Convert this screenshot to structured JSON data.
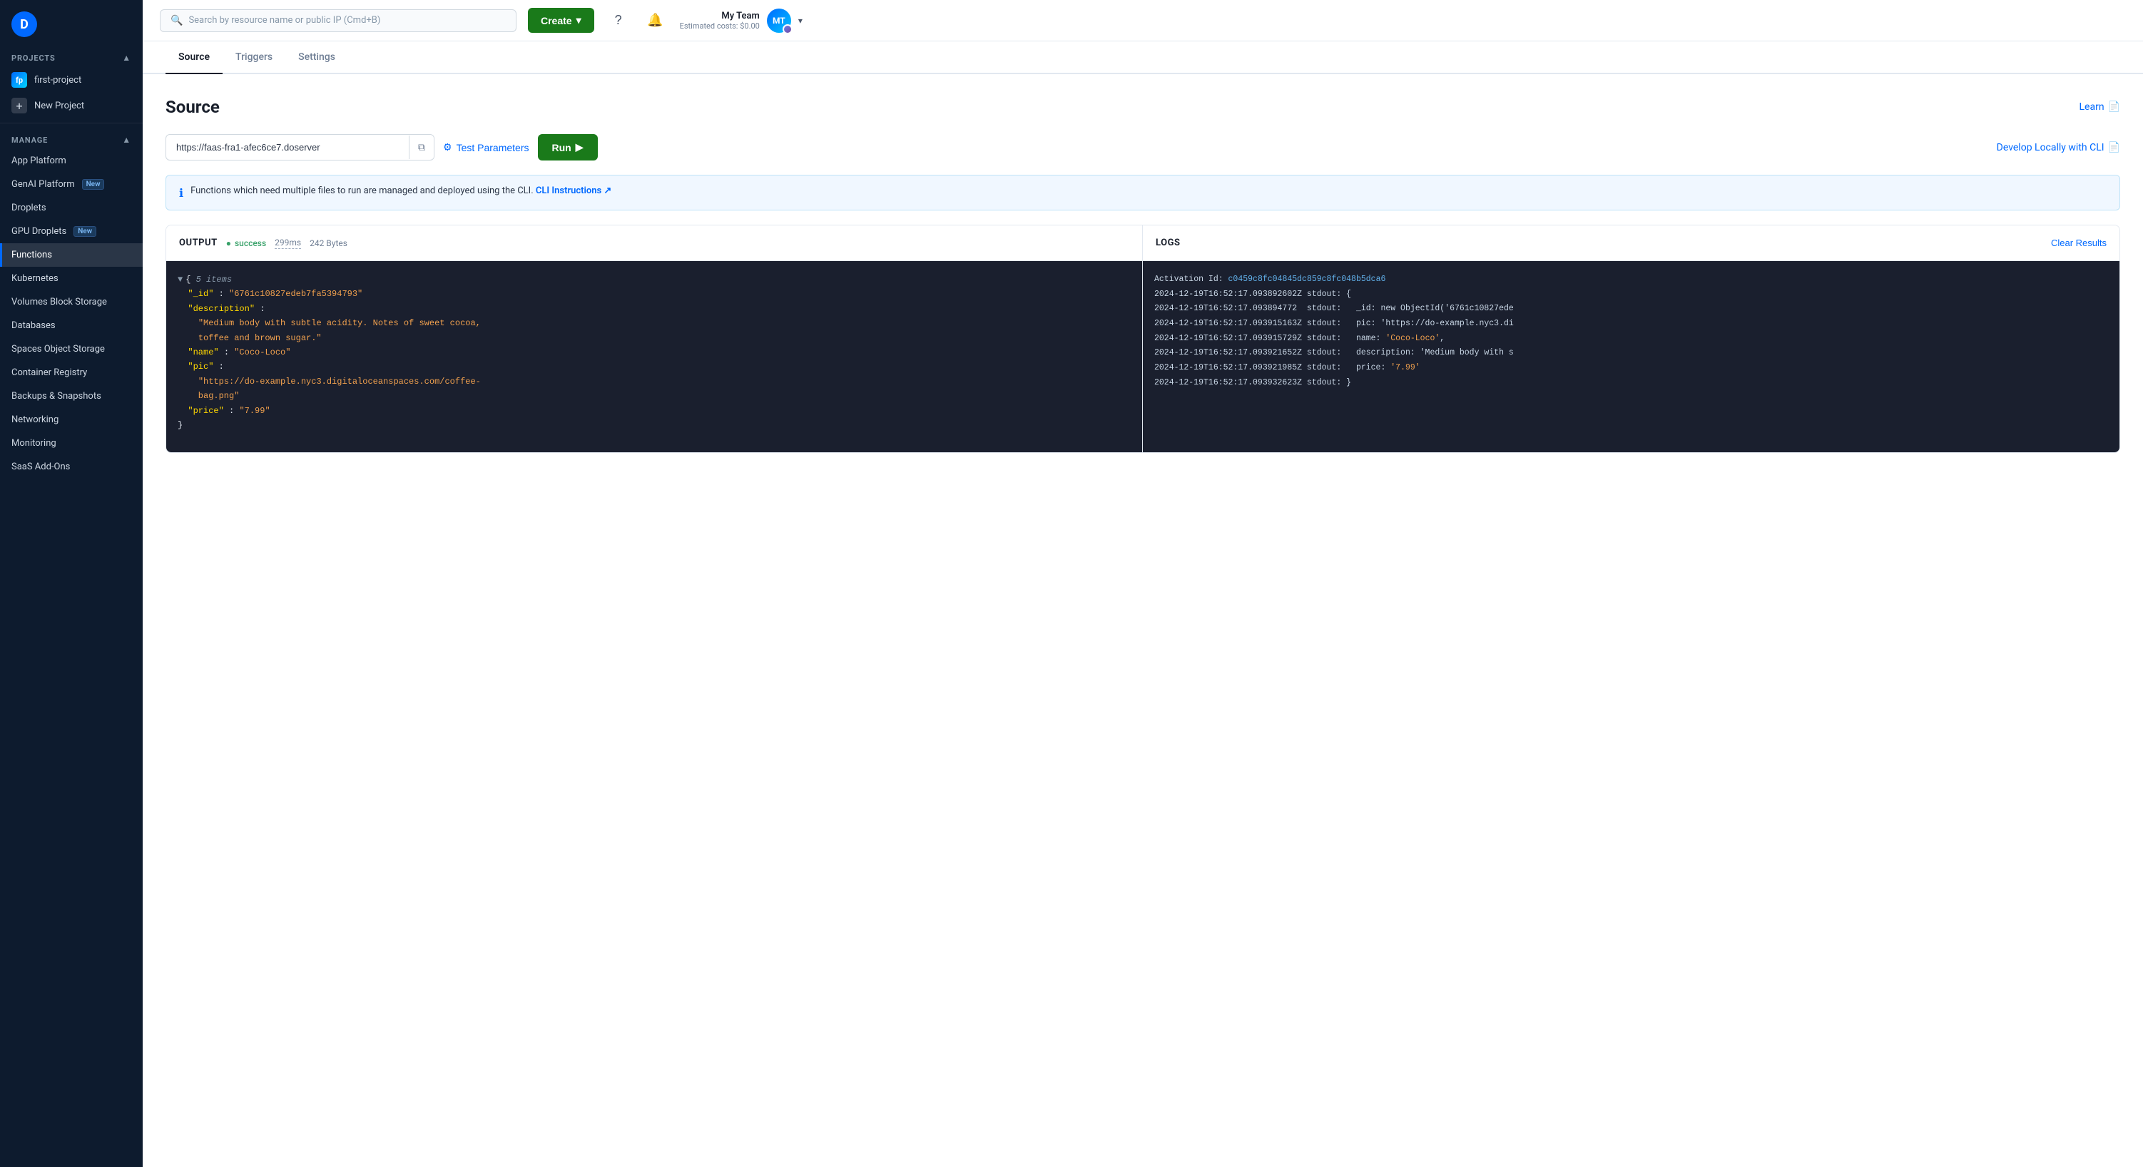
{
  "sidebar": {
    "logo_text": "D",
    "projects_section": "PROJECTS",
    "chevron_up": "▲",
    "projects": [
      {
        "id": "first-project",
        "label": "first-project",
        "icon_type": "gradient"
      }
    ],
    "new_project_label": "New Project",
    "manage_section": "MANAGE",
    "nav_items": [
      {
        "id": "app-platform",
        "label": "App Platform",
        "badge": null,
        "active": false
      },
      {
        "id": "genai-platform",
        "label": "GenAI Platform",
        "badge": "New",
        "active": false
      },
      {
        "id": "droplets",
        "label": "Droplets",
        "badge": null,
        "active": false
      },
      {
        "id": "gpu-droplets",
        "label": "GPU Droplets",
        "badge": "New",
        "active": false
      },
      {
        "id": "functions",
        "label": "Functions",
        "badge": null,
        "active": true
      },
      {
        "id": "kubernetes",
        "label": "Kubernetes",
        "badge": null,
        "active": false
      },
      {
        "id": "volumes-block-storage",
        "label": "Volumes Block Storage",
        "badge": null,
        "active": false
      },
      {
        "id": "databases",
        "label": "Databases",
        "badge": null,
        "active": false
      },
      {
        "id": "spaces-object-storage",
        "label": "Spaces Object Storage",
        "badge": null,
        "active": false
      },
      {
        "id": "container-registry",
        "label": "Container Registry",
        "badge": null,
        "active": false
      },
      {
        "id": "backups-snapshots",
        "label": "Backups & Snapshots",
        "badge": null,
        "active": false
      },
      {
        "id": "networking",
        "label": "Networking",
        "badge": null,
        "active": false
      },
      {
        "id": "monitoring",
        "label": "Monitoring",
        "badge": null,
        "active": false
      },
      {
        "id": "saas-add-ons",
        "label": "SaaS Add-Ons",
        "badge": null,
        "active": false
      }
    ]
  },
  "topnav": {
    "search_placeholder": "Search by resource name or public IP (Cmd+B)",
    "create_label": "Create",
    "user_name": "My Team",
    "user_cost": "Estimated costs: $0.00",
    "avatar_initials": "MT"
  },
  "tabs": [
    {
      "id": "source",
      "label": "Source",
      "active": true
    },
    {
      "id": "triggers",
      "label": "Triggers",
      "active": false
    },
    {
      "id": "settings",
      "label": "Settings",
      "active": false
    }
  ],
  "source_page": {
    "title": "Source",
    "learn_label": "Learn",
    "url_value": "https://faas-fra1-afec6ce7.doserver",
    "url_placeholder": "https://faas-fra1-afec6ce7.doserver",
    "test_params_label": "Test Parameters",
    "run_label": "Run",
    "run_icon": "▶",
    "develop_label": "Develop Locally with CLI",
    "info_text": "Functions which need multiple files to run are managed and deployed using the CLI.",
    "cli_link_text": "CLI Instructions ↗",
    "output_section": {
      "title": "OUTPUT",
      "status": "success",
      "timing": "299ms",
      "size": "242 Bytes",
      "json_content": [
        "▼ {  5 items",
        "  \"_id\" : \"6761c10827edeb7fa5394793\"",
        "  \"description\" :",
        "    \"Medium body with subtle acidity. Notes of sweet cocoa,",
        "    toffee and brown sugar.\"",
        "  \"name\" : \"Coco-Loco\"",
        "  \"pic\" :",
        "    \"https://do-example.nyc3.digitaloceanspaces.com/coffee-",
        "    bag.png\"",
        "  \"price\" : \"7.99\"",
        "}"
      ]
    },
    "logs_section": {
      "title": "LOGS",
      "clear_label": "Clear Results",
      "activation_id": "c0459c8fc04845dc859c8fc048b5dca6",
      "log_lines": [
        "Activation Id: c0459c8fc04845dc859c8fc048b5dca6",
        "2024-12-19T16:52:17.093892602Z stdout: {",
        "2024-12-19T16:52:17.093894772  stdout:   _id: new ObjectId('6761c10827ede",
        "2024-12-19T16:52:17.093915163Z stdout:   pic: 'https://do-example.nyc3.di",
        "2024-12-19T16:52:17.093915729Z stdout:   name: 'Coco-Loco',",
        "2024-12-19T16:52:17.093921652Z stdout:   description: 'Medium body with s",
        "2024-12-19T16:52:17.093921985Z stdout:   price: '7.99'",
        "2024-12-19T16:52:17.093932623Z stdout: }"
      ]
    }
  }
}
